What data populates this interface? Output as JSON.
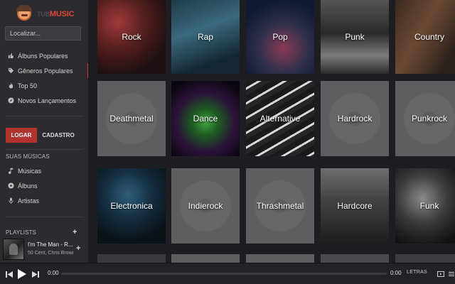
{
  "app": {
    "logo_text_prefix": "TUB",
    "logo_text_main": "MUSIC"
  },
  "search": {
    "placeholder": "Localizar..."
  },
  "nav": {
    "items": [
      {
        "label": "Álbuns Populares",
        "icon": "thumbs-up-icon",
        "active": false
      },
      {
        "label": "Gêneros Populares",
        "icon": "tag-icon",
        "active": true
      },
      {
        "label": "Top 50",
        "icon": "fire-icon",
        "active": false
      },
      {
        "label": "Novos Lançamentos",
        "icon": "compass-icon",
        "active": false
      }
    ]
  },
  "auth": {
    "login_label": "LOGAR",
    "register_label": "CADASTRO"
  },
  "my_music": {
    "title": "SUAS MÚSICAS",
    "items": [
      {
        "label": "Músicas",
        "icon": "music-note-icon"
      },
      {
        "label": "Álbuns",
        "icon": "disc-icon"
      },
      {
        "label": "Artistas",
        "icon": "microphone-icon"
      }
    ]
  },
  "playlists": {
    "title": "PLAYLISTS"
  },
  "now_playing": {
    "title": "I'm The Man - R...",
    "artist": "50 Cent, Chris Browi"
  },
  "genres": [
    {
      "label": "Rock",
      "style": "photo"
    },
    {
      "label": "Rap",
      "style": "photo"
    },
    {
      "label": "Pop",
      "style": "photo"
    },
    {
      "label": "Punk",
      "style": "photo"
    },
    {
      "label": "Country",
      "style": "photo"
    },
    {
      "label": "Deathmetal",
      "style": "placeholder"
    },
    {
      "label": "Dance",
      "style": "photo"
    },
    {
      "label": "Alternative",
      "style": "photo"
    },
    {
      "label": "Hardrock",
      "style": "placeholder"
    },
    {
      "label": "Punkrock",
      "style": "placeholder"
    },
    {
      "label": "Electronica",
      "style": "photo"
    },
    {
      "label": "Indierock",
      "style": "placeholder"
    },
    {
      "label": "Thrashmetal",
      "style": "placeholder"
    },
    {
      "label": "Hardcore",
      "style": "photo"
    },
    {
      "label": "Funk",
      "style": "photo"
    }
  ],
  "player": {
    "current_time": "0:00",
    "duration": "0:00",
    "lyrics_label": "LETRAS",
    "progress_fraction": 0
  },
  "colors": {
    "accent": "#c93b35",
    "sidebar_bg": "#2b2b30",
    "placeholder_tile": "#5e5e60"
  }
}
